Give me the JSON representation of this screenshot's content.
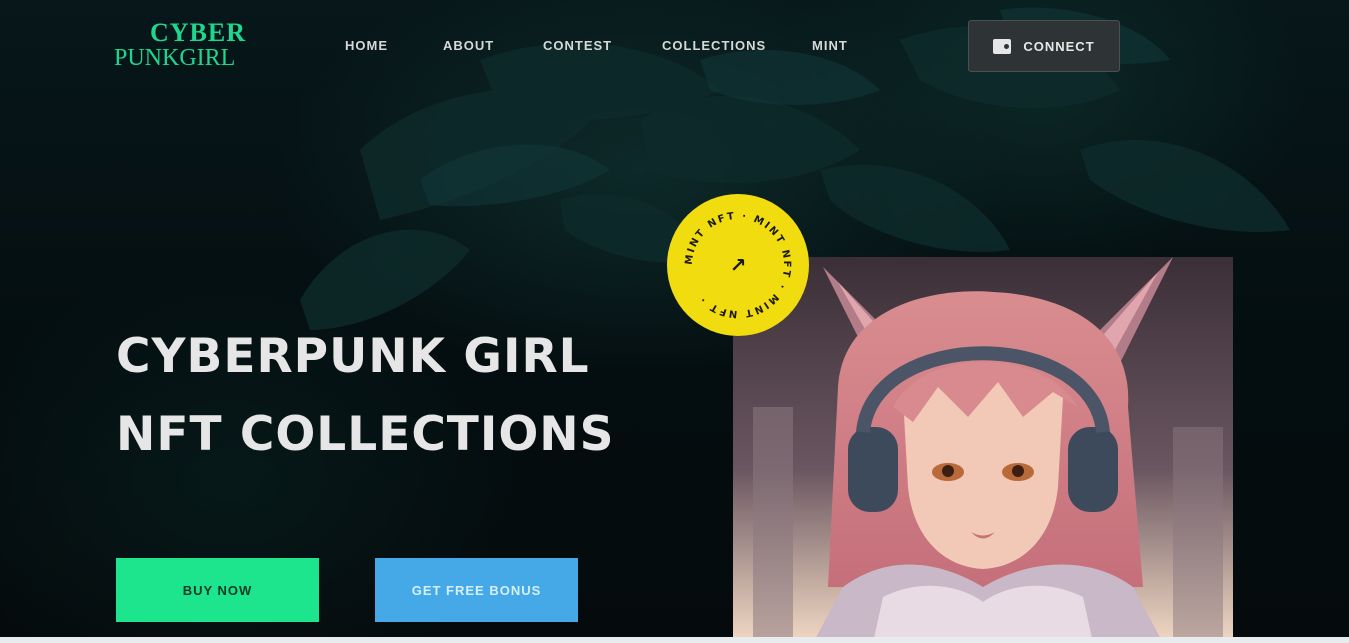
{
  "header": {
    "logo_line1": "CYBER",
    "logo_line2": "PUNKGIRL",
    "nav": [
      "HOME",
      "ABOUT",
      "CONTEST",
      "COLLECTIONS",
      "MINT"
    ],
    "connect_label": "CONNECT"
  },
  "hero": {
    "title_line1": "CYBERPUNK GIRL",
    "title_line2": "NFT COLLECTIONS",
    "buy_label": "BUY NOW",
    "bonus_label": "GET FREE BONUS"
  },
  "badge": {
    "ring_text": "MINT NFT · MINT NFT · MINT NFT ·",
    "icon": "arrow-up-right-icon"
  },
  "colors": {
    "accent_green": "#1de58e",
    "accent_blue": "#44a9e6",
    "badge_yellow": "#f1dc0f",
    "logo_green": "#1ed68d"
  }
}
